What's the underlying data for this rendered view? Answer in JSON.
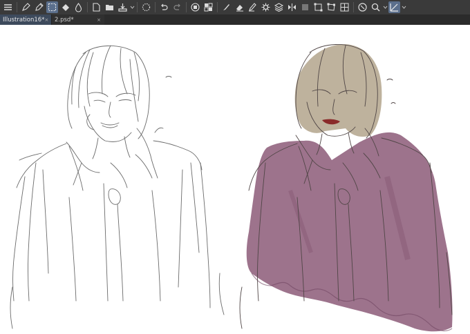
{
  "tabs": [
    {
      "label": "Illustration16*",
      "close": "×"
    },
    {
      "label": "2.psd*",
      "close": "×"
    }
  ],
  "colors": {
    "coat_fill": "#8c5a78",
    "hair_fill": "#b3a48c",
    "lips": "#8a2a2a",
    "toolbar_bg": "#3a3a3a",
    "tab_active": "#3d4a5c"
  },
  "toolbar_icons": [
    "menu-icon",
    "pen-icon",
    "pencil-icon",
    "marquee-icon",
    "fill-icon",
    "blend-icon",
    "new-file-icon",
    "open-icon",
    "save-icon",
    "loading-icon",
    "undo-icon",
    "redo-icon",
    "layer-icon",
    "grid-icon",
    "brush-icon",
    "eraser-icon",
    "pen-tool-icon",
    "gear-tool-icon",
    "layers-icon",
    "flip-icon",
    "select-icon",
    "transform-icon",
    "crop-icon",
    "navigator-icon",
    "zoom-icon",
    "ruler-icon"
  ]
}
